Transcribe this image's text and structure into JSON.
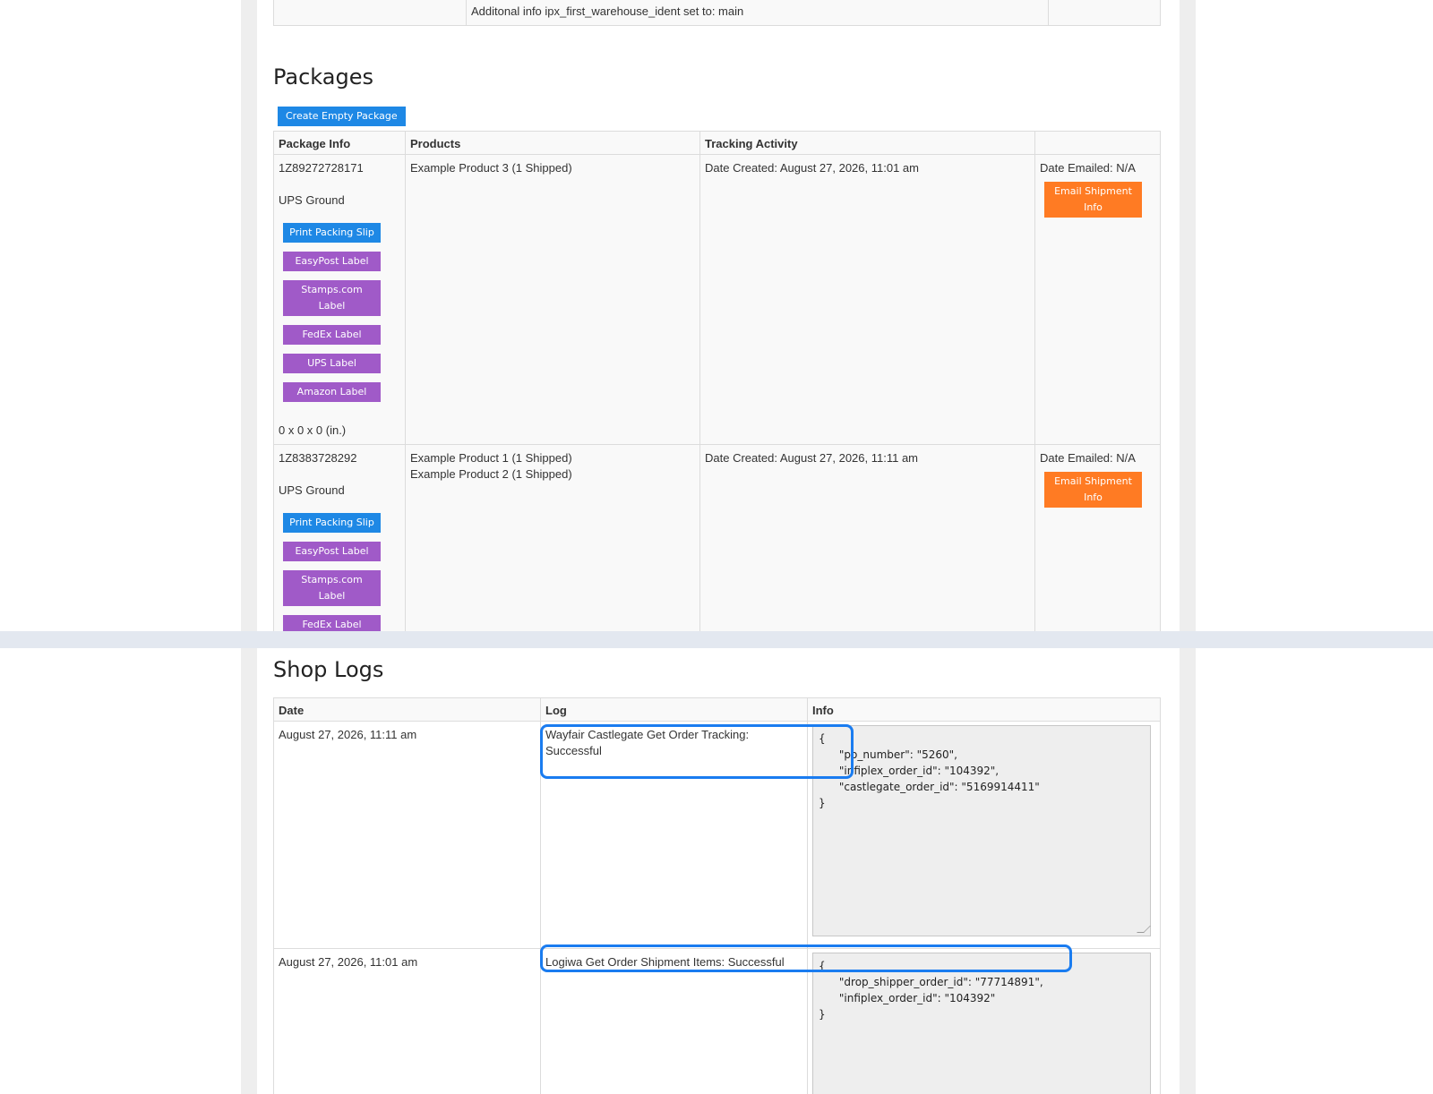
{
  "top_row": {
    "info": "Additonal info ipx_first_warehouse_ident set to: main"
  },
  "packages": {
    "title": "Packages",
    "create_button": "Create Empty Package",
    "headers": [
      "Package Info",
      "Products",
      "Tracking Activity",
      ""
    ],
    "items": [
      {
        "tracking": "1Z89272728171",
        "service": "UPS Ground",
        "buttons": [
          "Print Packing Slip",
          "EasyPost Label",
          "Stamps.com Label",
          "FedEx Label",
          "UPS Label",
          "Amazon Label"
        ],
        "dimensions": "0 x 0 x 0 (in.)",
        "products": [
          "Example Product 3 (1 Shipped)"
        ],
        "tracking_activity": "Date Created: August 27, 2026, 11:01 am",
        "date_emailed": "Date Emailed: N/A",
        "email_button": "Email Shipment Info"
      },
      {
        "tracking": "1Z8383728292",
        "service": "UPS Ground",
        "buttons": [
          "Print Packing Slip",
          "EasyPost Label",
          "Stamps.com Label",
          "FedEx Label"
        ],
        "products": [
          "Example Product 1 (1 Shipped)",
          "Example Product 2 (1 Shipped)"
        ],
        "tracking_activity": "Date Created: August 27, 2026, 11:11 am",
        "date_emailed": "Date Emailed: N/A",
        "email_button": "Email Shipment Info"
      }
    ]
  },
  "shop_logs": {
    "title": "Shop Logs",
    "headers": [
      "Date",
      "Log",
      "Info"
    ],
    "rows": [
      {
        "date": "August 27, 2026, 11:11 am",
        "log": "Wayfair Castlegate Get Order Tracking: Successful",
        "info": "{\n      \"po_number\": \"5260\",\n      \"infiplex_order_id\": \"104392\",\n      \"castlegate_order_id\": \"5169914411\"\n}"
      },
      {
        "date": "August 27, 2026, 11:01 am",
        "log": "Logiwa Get Order Shipment Items: Successful",
        "info": "{\n      \"drop_shipper_order_id\": \"77714891\",\n      \"infiplex_order_id\": \"104392\"\n}"
      }
    ]
  },
  "colors": {
    "primary_button": "#1e88e5",
    "label_button": "#a05ac8",
    "email_button": "#ff7b23",
    "highlight": "#1a7cf0"
  }
}
